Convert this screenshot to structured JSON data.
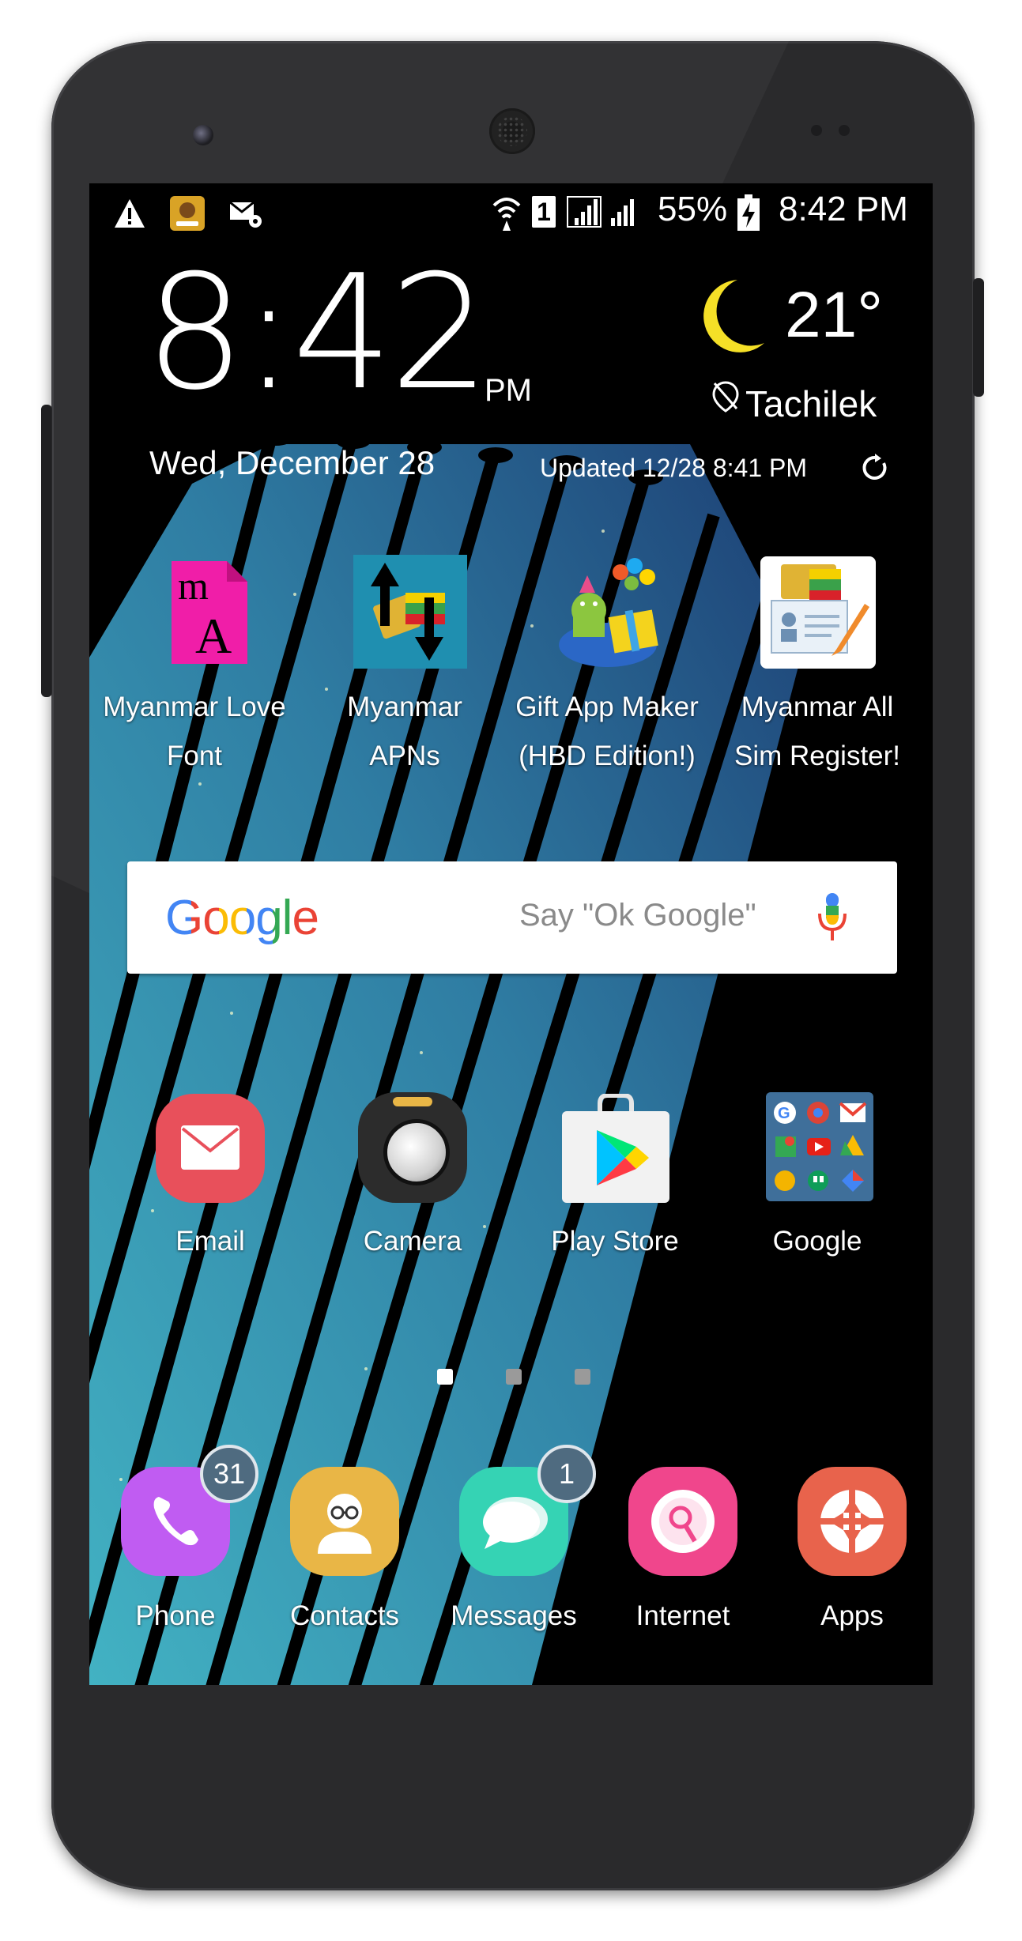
{
  "status_bar": {
    "battery": "55%",
    "time": "8:42 PM",
    "sim_slot": "1",
    "left_icons": [
      "warning-icon",
      "app-notification-icon",
      "mail-settings-icon"
    ],
    "right_icons": [
      "wifi-icon",
      "sim-icon",
      "signal-icon",
      "signal-icon",
      "battery-charging-icon"
    ]
  },
  "clock_widget": {
    "time": "8:42",
    "ampm": "PM",
    "date": "Wed, December 28"
  },
  "weather_widget": {
    "temperature": "21°",
    "location": "Tachilek",
    "updated": "Updated  12/28  8:41 PM",
    "condition_icon": "moon-icon"
  },
  "home_apps_row1": [
    {
      "line1": "Myanmar Love",
      "line2": "Font"
    },
    {
      "line1": "Myanmar",
      "line2": "APNs"
    },
    {
      "line1": "Gift App Maker",
      "line2": "(HBD Edition!)"
    },
    {
      "line1": "Myanmar All",
      "line2": "Sim Register!"
    }
  ],
  "google_search": {
    "logo": "Google",
    "hint": "Say \"Ok Google\""
  },
  "home_apps_row2": [
    {
      "label": "Email"
    },
    {
      "label": "Camera"
    },
    {
      "label": "Play Store"
    },
    {
      "label": "Google"
    }
  ],
  "page_indicator": {
    "pages": 3,
    "active": 1
  },
  "dock": [
    {
      "label": "Phone",
      "badge": "31"
    },
    {
      "label": "Contacts"
    },
    {
      "label": "Messages",
      "badge": "1"
    },
    {
      "label": "Internet"
    },
    {
      "label": "Apps"
    }
  ],
  "colors": {
    "email": "#e8505b",
    "phone": "#c05cf2",
    "contacts": "#e9b646",
    "messages": "#35d3b4",
    "internet": "#f0468c",
    "apps": "#e8634c",
    "wallpaper_accent": "#3ea3b8"
  }
}
